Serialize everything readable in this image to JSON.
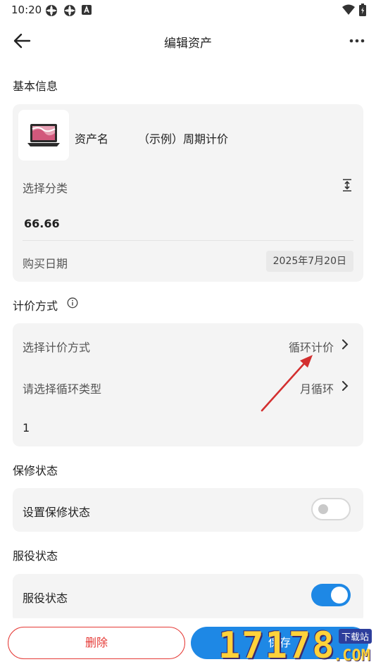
{
  "status_bar": {
    "time": "10:20"
  },
  "app_bar": {
    "title": "编辑资产"
  },
  "basic_info": {
    "section_title": "基本信息",
    "asset_name_label": "资产名",
    "asset_name_value": "（示例）周期计价",
    "category_label": "选择分类",
    "price_value": "66.66",
    "purchase_date_label": "购买日期",
    "purchase_date_value": "2025年7月20日"
  },
  "pricing": {
    "section_title": "计价方式",
    "method_label": "选择计价方式",
    "method_value": "循环计价",
    "cycle_type_label": "请选择循环类型",
    "cycle_type_value": "月循环",
    "cycle_count_value": "1"
  },
  "warranty": {
    "section_title": "保修状态",
    "toggle_label": "设置保修状态",
    "toggle_on": false
  },
  "service": {
    "section_title": "服役状态",
    "toggle_label": "服役状态",
    "toggle_on": true
  },
  "bottom_bar": {
    "delete_label": "删除",
    "save_label": "保存"
  },
  "watermark": {
    "digits": "17178",
    "badge": "下载站",
    "suffix": ".COM"
  },
  "colors": {
    "accent": "#1e88e5",
    "danger": "#e53935",
    "card_bg": "#f4f4f4",
    "annotation": "#d32f2f"
  }
}
